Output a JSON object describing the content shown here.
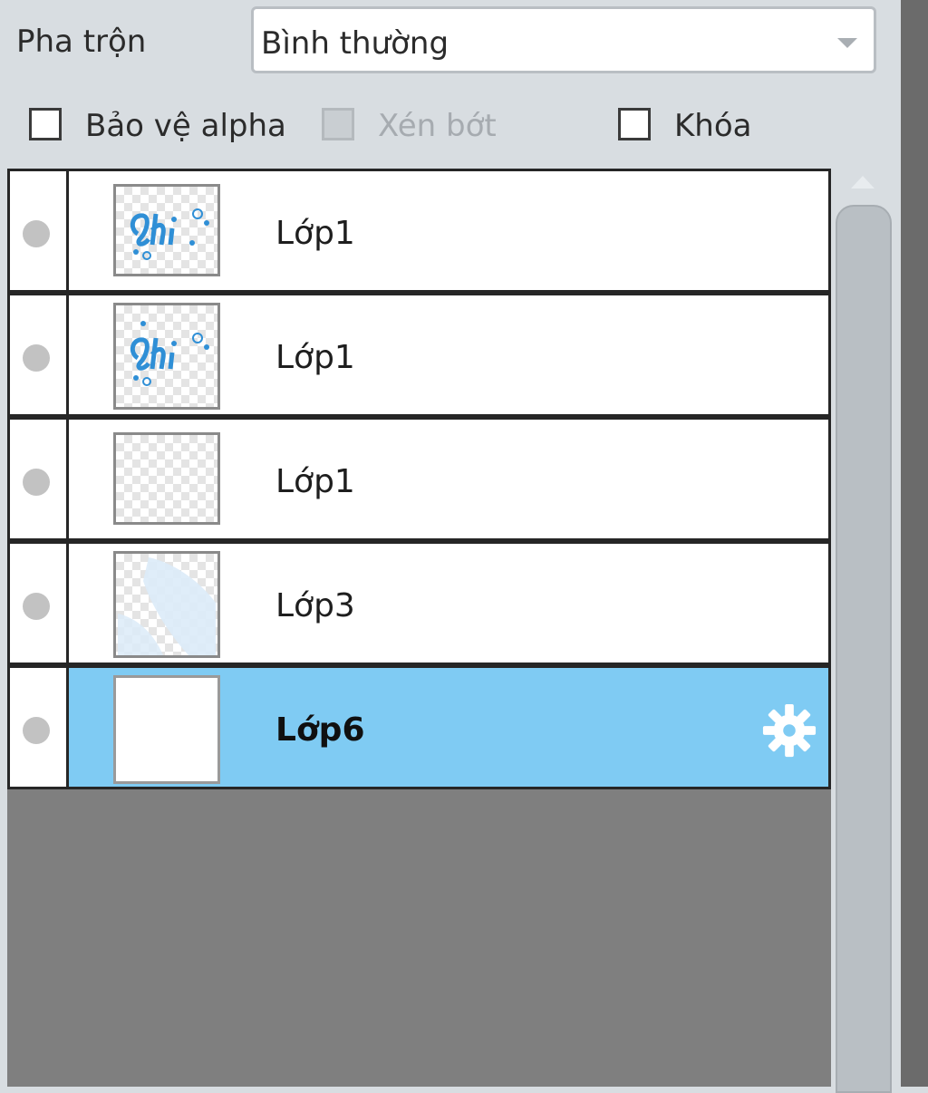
{
  "blend": {
    "label": "Pha trộn",
    "value": "Bình thường"
  },
  "options": {
    "protect_alpha": {
      "label": "Bảo vệ alpha",
      "checked": false,
      "enabled": true
    },
    "clip": {
      "label": "Xén bớt",
      "checked": false,
      "enabled": false
    },
    "lock": {
      "label": "Khóa",
      "checked": false,
      "enabled": true
    }
  },
  "layers": [
    {
      "name": "Lớp1",
      "thumb": "hi-lettering",
      "selected": false
    },
    {
      "name": "Lớp1",
      "thumb": "hi-lettering",
      "selected": false
    },
    {
      "name": "Lớp1",
      "thumb": "transparent",
      "selected": false
    },
    {
      "name": "Lớp3",
      "thumb": "light-blue-shapes",
      "selected": false
    },
    {
      "name": "Lớp6",
      "thumb": "white",
      "selected": true,
      "icon": "gear-icon"
    }
  ],
  "colors": {
    "selected_row": "#7fcbf3",
    "list_background": "#7f7f7f",
    "panel_background": "#d8dde1",
    "thumb_art": "#2f8fd6"
  }
}
